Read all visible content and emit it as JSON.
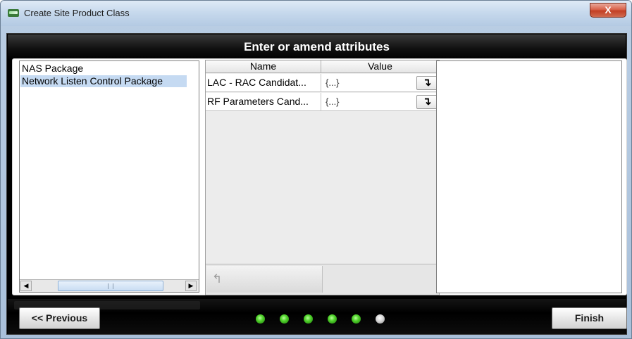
{
  "window": {
    "title": "Create Site Product Class",
    "close_label": "X"
  },
  "header": {
    "title": "Enter or amend attributes"
  },
  "packages": {
    "items": [
      {
        "label": "NAS Package",
        "selected": false
      },
      {
        "label": "Network Listen Control Package",
        "selected": true
      }
    ]
  },
  "attributes_table": {
    "columns": [
      "Name",
      "Value"
    ],
    "rows": [
      {
        "name": "LAC - RAC Candidat...",
        "value": "{...}",
        "action_icon": "↴"
      },
      {
        "name": "RF Parameters Cand...",
        "value": "{...}",
        "action_icon": "↴"
      }
    ],
    "up_icon": "↰"
  },
  "scrollbar": {
    "left_arrow": "◀",
    "right_arrow": "▶"
  },
  "footer": {
    "previous_label": "<< Previous",
    "finish_label": "Finish",
    "steps_total": 6,
    "steps_completed": 5,
    "step_active_color": "#4fd12a",
    "step_inactive_color": "#d5d5d5"
  }
}
